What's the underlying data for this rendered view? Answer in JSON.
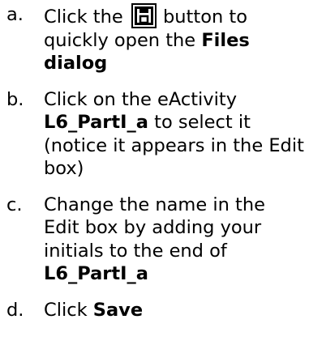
{
  "steps": [
    {
      "marker": "a.",
      "parts": {
        "t1": "Click the",
        "t2": "button to quickly open the",
        "b1": "Files dialog"
      },
      "icon": "save-disk-icon"
    },
    {
      "marker": "b.",
      "parts": {
        "t1": "Click on the eActivity",
        "b1": "L6_PartI_a",
        "t2": "to select it (notice it appears in the Edit box)"
      }
    },
    {
      "marker": "c.",
      "parts": {
        "t1": "Change the name in the Edit box by adding your initials to the end of",
        "b1": "L6_PartI_a"
      }
    },
    {
      "marker": "d.",
      "parts": {
        "t1": "Click",
        "b1": "Save"
      }
    }
  ]
}
